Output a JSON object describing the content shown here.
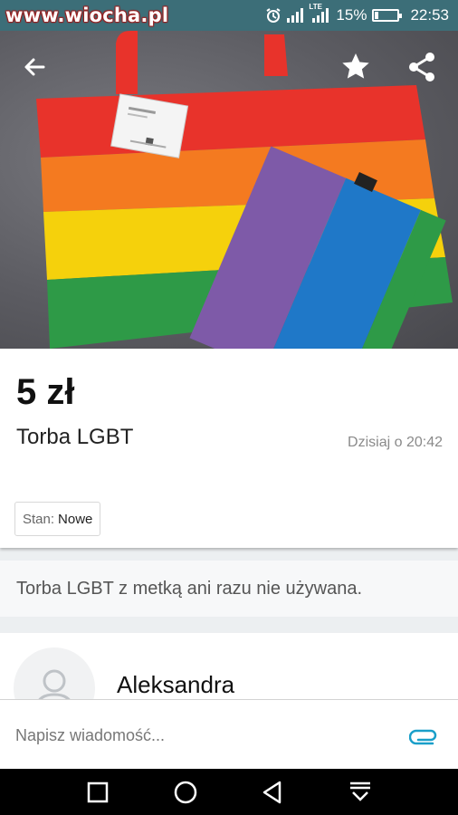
{
  "status_bar": {
    "watermark": "www.wiocha.pl",
    "network": "LTE",
    "battery": "15%",
    "battery_level": 0.15,
    "time": "22:53",
    "icons": [
      "alarm-icon",
      "signal-icon",
      "lte-signal-icon",
      "battery-icon"
    ]
  },
  "hero": {
    "icons": [
      "back-arrow-icon",
      "star-icon",
      "share-icon"
    ],
    "colors": [
      "#e8332b",
      "#f47a20",
      "#f5d10c",
      "#2e9a47",
      "#7e5aa8",
      "#1f78c8"
    ]
  },
  "listing": {
    "price": "5 zł",
    "title": "Torba LGBT",
    "date": "Dzisiaj o 20:42",
    "condition_label": "Stan:",
    "condition_value": "Nowe",
    "description": "Torba LGBT z metką ani razu nie używana."
  },
  "seller": {
    "name": "Aleksandra"
  },
  "composer": {
    "placeholder": "Napisz wiadomość...",
    "attach_icon": "paperclip-icon",
    "accent": "#1a9fc9"
  },
  "nav": {
    "icons": [
      "recents-icon",
      "home-icon",
      "back-icon",
      "notifications-icon"
    ]
  }
}
